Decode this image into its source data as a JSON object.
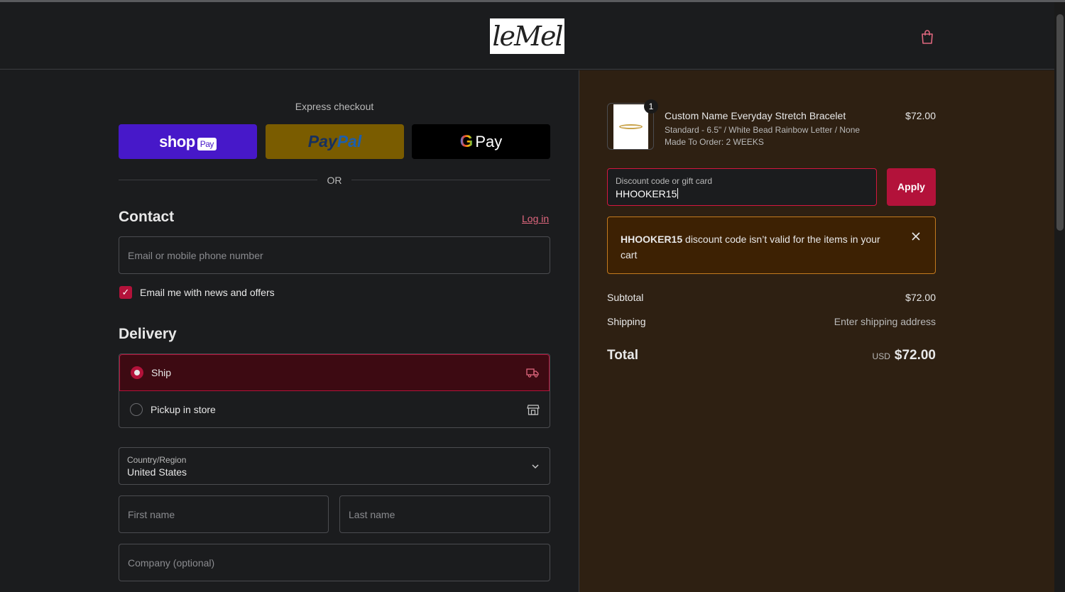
{
  "header": {
    "logo_text": "leMel",
    "cart_icon": "shopping-bag-icon"
  },
  "express": {
    "title": "Express checkout",
    "shop_pay_label": "shop",
    "shop_pay_badge": "Pay",
    "paypal_label_a": "Pay",
    "paypal_label_b": "Pal",
    "gpay_g": "G",
    "gpay_label": "Pay",
    "or": "OR"
  },
  "contact": {
    "title": "Contact",
    "login": "Log in",
    "email_placeholder": "Email or mobile phone number",
    "newsletter_label": "Email me with news and offers",
    "newsletter_checked": true
  },
  "delivery": {
    "title": "Delivery",
    "options": [
      {
        "label": "Ship",
        "selected": true,
        "icon": "truck-icon"
      },
      {
        "label": "Pickup in store",
        "selected": false,
        "icon": "store-icon"
      }
    ],
    "country_label": "Country/Region",
    "country_value": "United States",
    "first_name_placeholder": "First name",
    "last_name_placeholder": "Last name",
    "company_placeholder": "Company (optional)"
  },
  "summary": {
    "item": {
      "quantity": "1",
      "name": "Custom Name Everyday Stretch Bracelet",
      "variant": "Standard - 6.5\" / White Bead Rainbow Letter / None",
      "note": "Made To Order: 2 WEEKS",
      "price": "$72.00"
    },
    "discount_label": "Discount code or gift card",
    "discount_value": "HHOOKER15",
    "apply_label": "Apply",
    "alert_code": "HHOOKER15",
    "alert_text": " discount code isn’t valid for the items in your cart",
    "subtotal_label": "Subtotal",
    "subtotal_value": "$72.00",
    "shipping_label": "Shipping",
    "shipping_value": "Enter shipping address",
    "total_label": "Total",
    "total_currency": "USD",
    "total_value": "$72.00"
  },
  "colors": {
    "accent": "#b3123a",
    "shop_pay": "#4718c9",
    "paypal": "#7a5c00",
    "alert_border": "#c37a1e"
  }
}
